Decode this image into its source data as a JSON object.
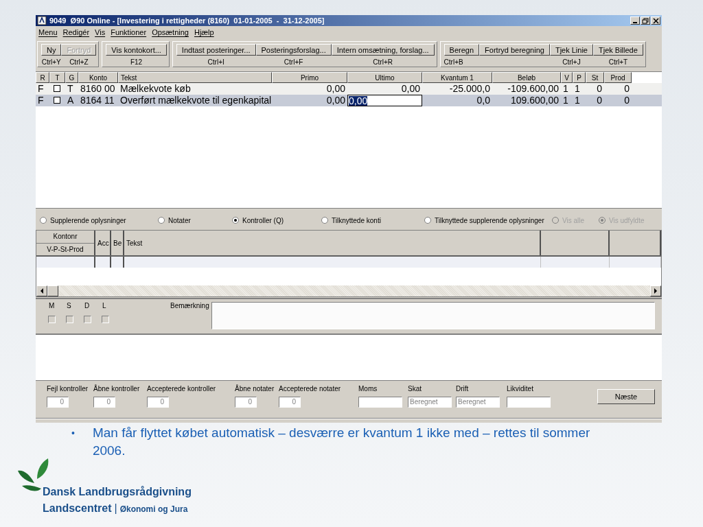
{
  "window": {
    "title": "9049  Ø90 Online - [Investering i rettigheder (8160)  01-01-2005  -  31-12-2005]"
  },
  "menu": [
    "Menu",
    "Redigér",
    "Vis",
    "Funktioner",
    "Opsætning",
    "Hjælp"
  ],
  "toolbar": {
    "groups": [
      [
        {
          "label": "Ny",
          "shortcut": "Ctrl+Y",
          "disabled": false
        },
        {
          "label": "Fortryd",
          "shortcut": "Ctrl+Z",
          "disabled": true
        }
      ],
      [
        {
          "label": "Vis kontokort...",
          "shortcut": "F12",
          "disabled": false
        }
      ],
      [
        {
          "label": "Indtast posteringer...",
          "shortcut": "Ctrl+I",
          "disabled": false
        },
        {
          "label": "Posteringsforslag...",
          "shortcut": "Ctrl+F",
          "disabled": false
        },
        {
          "label": "Intern omsætning, forslag...",
          "shortcut": "Ctrl+R",
          "disabled": false
        }
      ],
      [
        {
          "label": "Beregn",
          "shortcut": "Ctrl+B",
          "disabled": false
        },
        {
          "label": "Fortryd beregning",
          "disabled": false
        },
        {
          "label": "Tjek Linie",
          "shortcut": "Ctrl+J",
          "disabled": false
        },
        {
          "label": "Tjek Billede",
          "shortcut": "Ctrl+T",
          "disabled": false
        }
      ]
    ]
  },
  "table": {
    "columns": [
      "R",
      "T",
      "G",
      "Konto",
      "Tekst",
      "Primo",
      "Ultimo",
      "Kvantum 1",
      "Beløb",
      "V",
      "P",
      "St",
      "Prod"
    ],
    "rows": [
      {
        "r": "F",
        "checked": false,
        "g": "T",
        "konto": "8160 00",
        "tekst": "Mælkekvote køb",
        "primo": "0,00",
        "ultimo": "0,00",
        "kvantum": "-25.000,0",
        "belob": "-109.600,00",
        "v": "1",
        "p": "1",
        "st": "0",
        "prod": "0",
        "selected": false
      },
      {
        "r": "F",
        "checked": false,
        "g": "A",
        "konto": "8164 11",
        "tekst": "Overført mælkekvote til egenkapital",
        "primo": "0,00",
        "ultimo": "0,00",
        "kvantum": "0,0",
        "belob": "109.600,00",
        "v": "1",
        "p": "1",
        "st": "0",
        "prod": "0",
        "selected": true
      }
    ]
  },
  "view_options": [
    {
      "label": "Supplerende oplysninger",
      "selected": false,
      "disabled": false
    },
    {
      "label": "Notater",
      "selected": false,
      "disabled": false
    },
    {
      "label": "Kontroller (Q)",
      "selected": true,
      "disabled": false
    },
    {
      "label": "Tilknyttede konti",
      "selected": false,
      "disabled": false
    },
    {
      "label": "Tilknyttede supplerende oplysninger",
      "selected": false,
      "disabled": false
    },
    {
      "label": "Vis alle",
      "selected": false,
      "disabled": true
    },
    {
      "label": "Vis udfyldte",
      "selected": true,
      "disabled": true
    }
  ],
  "controls_table": {
    "columns": [
      "Kontonr",
      "V-P-St-Prod",
      "Acc",
      "Be",
      "Tekst"
    ]
  },
  "flags": [
    {
      "label": "M",
      "checked": false
    },
    {
      "label": "S",
      "checked": false
    },
    {
      "label": "D",
      "checked": false
    },
    {
      "label": "L",
      "checked": false
    }
  ],
  "remark": {
    "label": "Bemærkning"
  },
  "totals": [
    {
      "label": "Fejl kontroller",
      "value": "0"
    },
    {
      "label": "Åbne kontroller",
      "value": "0"
    },
    {
      "label": "Accepterede kontroller",
      "value": "0"
    },
    {
      "label": "Åbne notater",
      "value": "0"
    },
    {
      "label": "Accepterede notater",
      "value": "0"
    },
    {
      "label": "Moms"
    },
    {
      "label": "Skat",
      "value": "Beregnet"
    },
    {
      "label": "Drift",
      "value": "Beregnet"
    },
    {
      "label": "Likviditet"
    }
  ],
  "next_button": "Næste",
  "slide": {
    "bullet": "•",
    "text": "Man får flyttet købet automatisk – desværre er kvantum 1 ikke med – rettes til sommer 2006.",
    "brand": "Dansk Landbrugsrådgivning",
    "org": "Landscentret",
    "separator": "|",
    "unit": "Økonomi og Jura"
  }
}
